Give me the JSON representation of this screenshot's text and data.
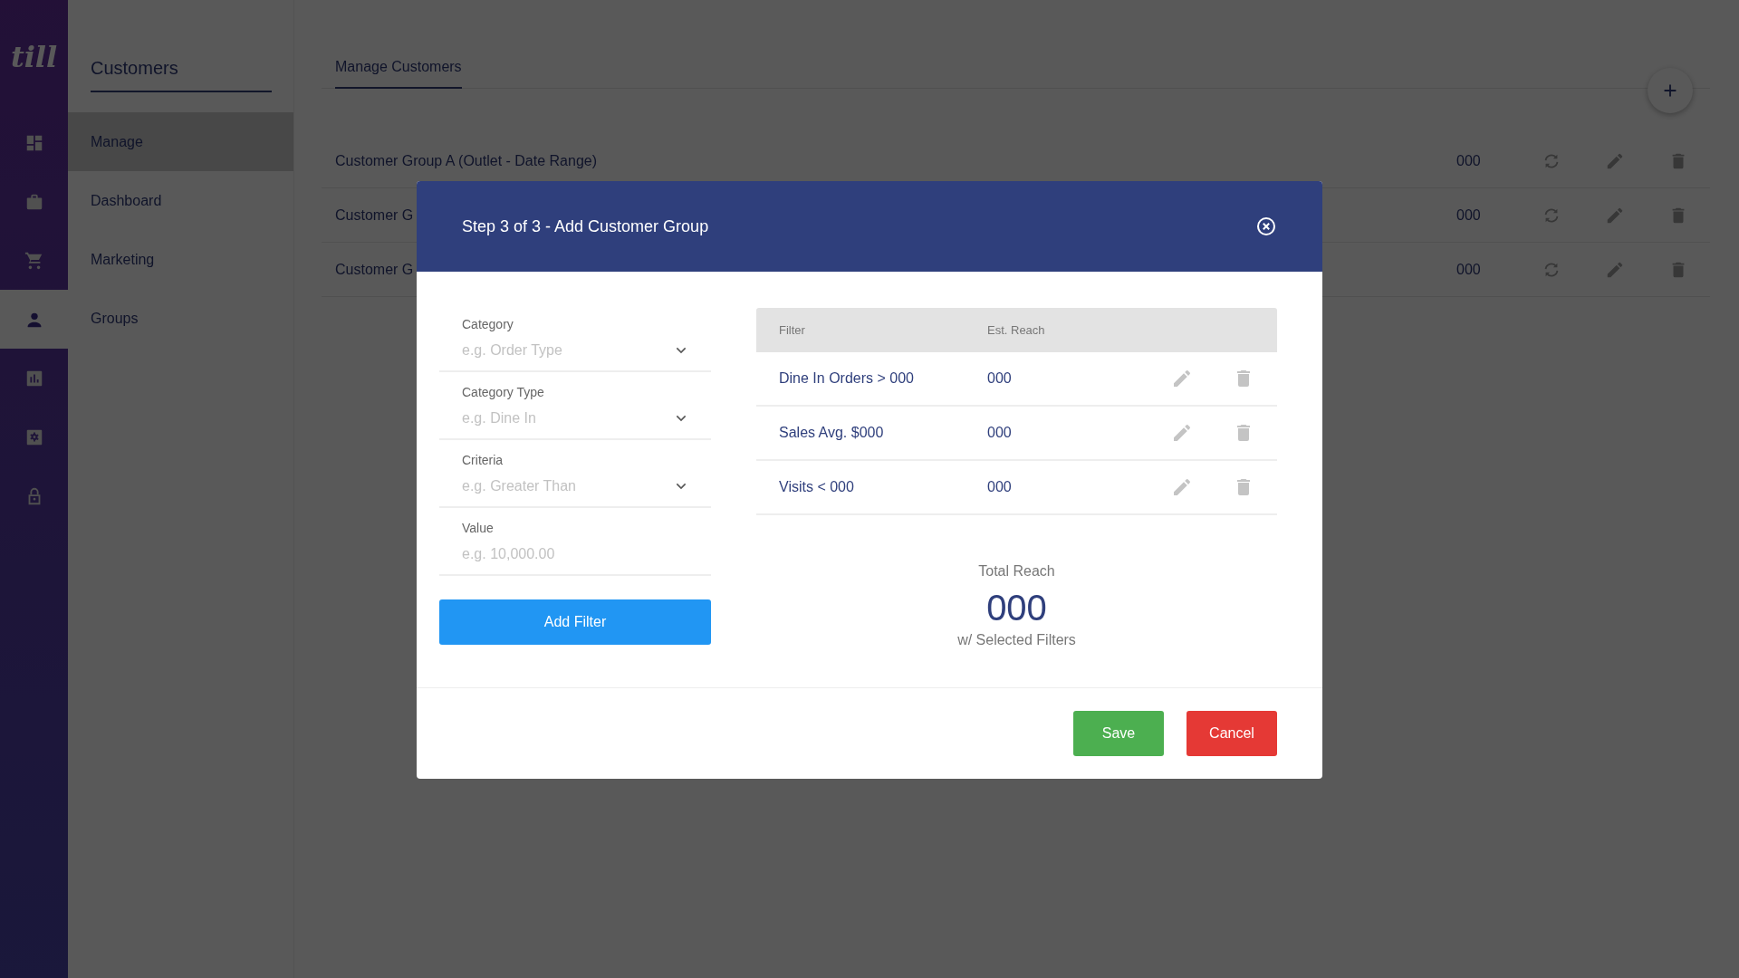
{
  "logo": "till",
  "rail": [
    {
      "selected": false
    },
    {
      "selected": false
    },
    {
      "selected": false
    },
    {
      "selected": true
    },
    {
      "selected": false
    },
    {
      "selected": false
    },
    {
      "selected": false
    }
  ],
  "sidebar": {
    "title": "Customers",
    "items": [
      {
        "label": "Manage",
        "selected": true
      },
      {
        "label": "Dashboard",
        "selected": false
      },
      {
        "label": "Marketing",
        "selected": false
      },
      {
        "label": "Groups",
        "selected": false
      }
    ]
  },
  "tabs": [
    {
      "label": "Manage Customers",
      "selected": true
    }
  ],
  "groups": [
    {
      "name": "Customer Group A (Outlet - Date Range)",
      "count": "000"
    },
    {
      "name": "Customer G",
      "count": "000"
    },
    {
      "name": "Customer G",
      "count": "000"
    }
  ],
  "modal": {
    "title": "Step 3 of 3 - Add Customer Group",
    "fields": [
      {
        "kind": "select",
        "label": "Category",
        "placeholder": "e.g. Order Type"
      },
      {
        "kind": "select",
        "label": "Category Type",
        "placeholder": "e.g. Dine In"
      },
      {
        "kind": "select",
        "label": "Criteria",
        "placeholder": "e.g. Greater Than"
      },
      {
        "kind": "text",
        "label": "Value",
        "placeholder": "e.g. 10,000.00"
      }
    ],
    "add_button": "Add Filter",
    "table": {
      "columns": [
        "Filter",
        "Est. Reach"
      ],
      "rows": [
        {
          "filter": "Dine In Orders > 000",
          "reach": "000"
        },
        {
          "filter": "Sales Avg. $000",
          "reach": "000"
        },
        {
          "filter": "Visits < 000",
          "reach": "000"
        }
      ]
    },
    "total": {
      "label": "Total Reach",
      "value": "000",
      "caption": "w/ Selected Filters"
    },
    "buttons": {
      "save": "Save",
      "cancel": "Cancel"
    }
  }
}
